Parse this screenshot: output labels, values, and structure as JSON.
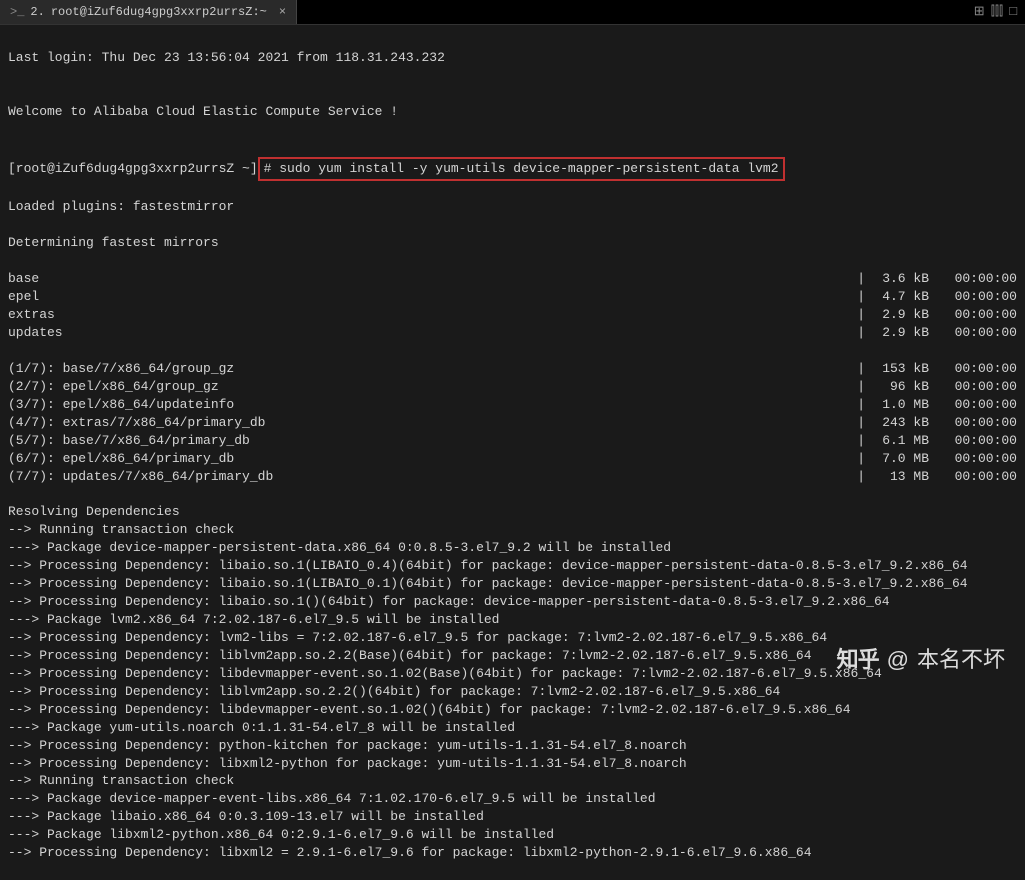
{
  "tab": {
    "icon": ">_",
    "index": "2.",
    "title": "root@iZuf6dug4gpg3xxrp2urrsZ:~",
    "close": "×"
  },
  "winicons": {
    "a": "⊞",
    "b": "⫿⫿⫿",
    "c": "□"
  },
  "login_line": "Last login: Thu Dec 23 13:56:04 2021 from 118.31.243.232",
  "blank": "",
  "welcome": "Welcome to Alibaba Cloud Elastic Compute Service !",
  "prompt": {
    "text": "[root@iZuf6dug4gpg3xxrp2urrsZ ~]",
    "hash": "#",
    "cmd": " sudo yum install -y yum-utils device-mapper-persistent-data lvm2"
  },
  "plugins": "Loaded plugins: fastestmirror",
  "determine": "Determining fastest mirrors",
  "repos": [
    {
      "name": "base",
      "size": "3.6 kB",
      "time": "00:00:00"
    },
    {
      "name": "epel",
      "size": "4.7 kB",
      "time": "00:00:00"
    },
    {
      "name": "extras",
      "size": "2.9 kB",
      "time": "00:00:00"
    },
    {
      "name": "updates",
      "size": "2.9 kB",
      "time": "00:00:00"
    }
  ],
  "downloads": [
    {
      "name": "(1/7): base/7/x86_64/group_gz",
      "size": "153 kB",
      "time": "00:00:00"
    },
    {
      "name": "(2/7): epel/x86_64/group_gz",
      "size": " 96 kB",
      "time": "00:00:00"
    },
    {
      "name": "(3/7): epel/x86_64/updateinfo",
      "size": "1.0 MB",
      "time": "00:00:00"
    },
    {
      "name": "(4/7): extras/7/x86_64/primary_db",
      "size": "243 kB",
      "time": "00:00:00"
    },
    {
      "name": "(5/7): base/7/x86_64/primary_db",
      "size": "6.1 MB",
      "time": "00:00:00"
    },
    {
      "name": "(6/7): epel/x86_64/primary_db",
      "size": "7.0 MB",
      "time": "00:00:00"
    },
    {
      "name": "(7/7): updates/7/x86_64/primary_db",
      "size": " 13 MB",
      "time": "00:00:00"
    }
  ],
  "deps": [
    "Resolving Dependencies",
    "--> Running transaction check",
    "---> Package device-mapper-persistent-data.x86_64 0:0.8.5-3.el7_9.2 will be installed",
    "--> Processing Dependency: libaio.so.1(LIBAIO_0.4)(64bit) for package: device-mapper-persistent-data-0.8.5-3.el7_9.2.x86_64",
    "--> Processing Dependency: libaio.so.1(LIBAIO_0.1)(64bit) for package: device-mapper-persistent-data-0.8.5-3.el7_9.2.x86_64",
    "--> Processing Dependency: libaio.so.1()(64bit) for package: device-mapper-persistent-data-0.8.5-3.el7_9.2.x86_64",
    "---> Package lvm2.x86_64 7:2.02.187-6.el7_9.5 will be installed",
    "--> Processing Dependency: lvm2-libs = 7:2.02.187-6.el7_9.5 for package: 7:lvm2-2.02.187-6.el7_9.5.x86_64",
    "--> Processing Dependency: liblvm2app.so.2.2(Base)(64bit) for package: 7:lvm2-2.02.187-6.el7_9.5.x86_64",
    "--> Processing Dependency: libdevmapper-event.so.1.02(Base)(64bit) for package: 7:lvm2-2.02.187-6.el7_9.5.x86_64",
    "--> Processing Dependency: liblvm2app.so.2.2()(64bit) for package: 7:lvm2-2.02.187-6.el7_9.5.x86_64",
    "--> Processing Dependency: libdevmapper-event.so.1.02()(64bit) for package: 7:lvm2-2.02.187-6.el7_9.5.x86_64",
    "---> Package yum-utils.noarch 0:1.1.31-54.el7_8 will be installed",
    "--> Processing Dependency: python-kitchen for package: yum-utils-1.1.31-54.el7_8.noarch",
    "--> Processing Dependency: libxml2-python for package: yum-utils-1.1.31-54.el7_8.noarch",
    "--> Running transaction check",
    "---> Package device-mapper-event-libs.x86_64 7:1.02.170-6.el7_9.5 will be installed",
    "---> Package libaio.x86_64 0:0.3.109-13.el7 will be installed",
    "---> Package libxml2-python.x86_64 0:2.9.1-6.el7_9.6 will be installed",
    "--> Processing Dependency: libxml2 = 2.9.1-6.el7_9.6 for package: libxml2-python-2.9.1-6.el7_9.6.x86_64"
  ],
  "watermark": {
    "logo": "知乎",
    "at": "@",
    "name": "本名不坏"
  }
}
